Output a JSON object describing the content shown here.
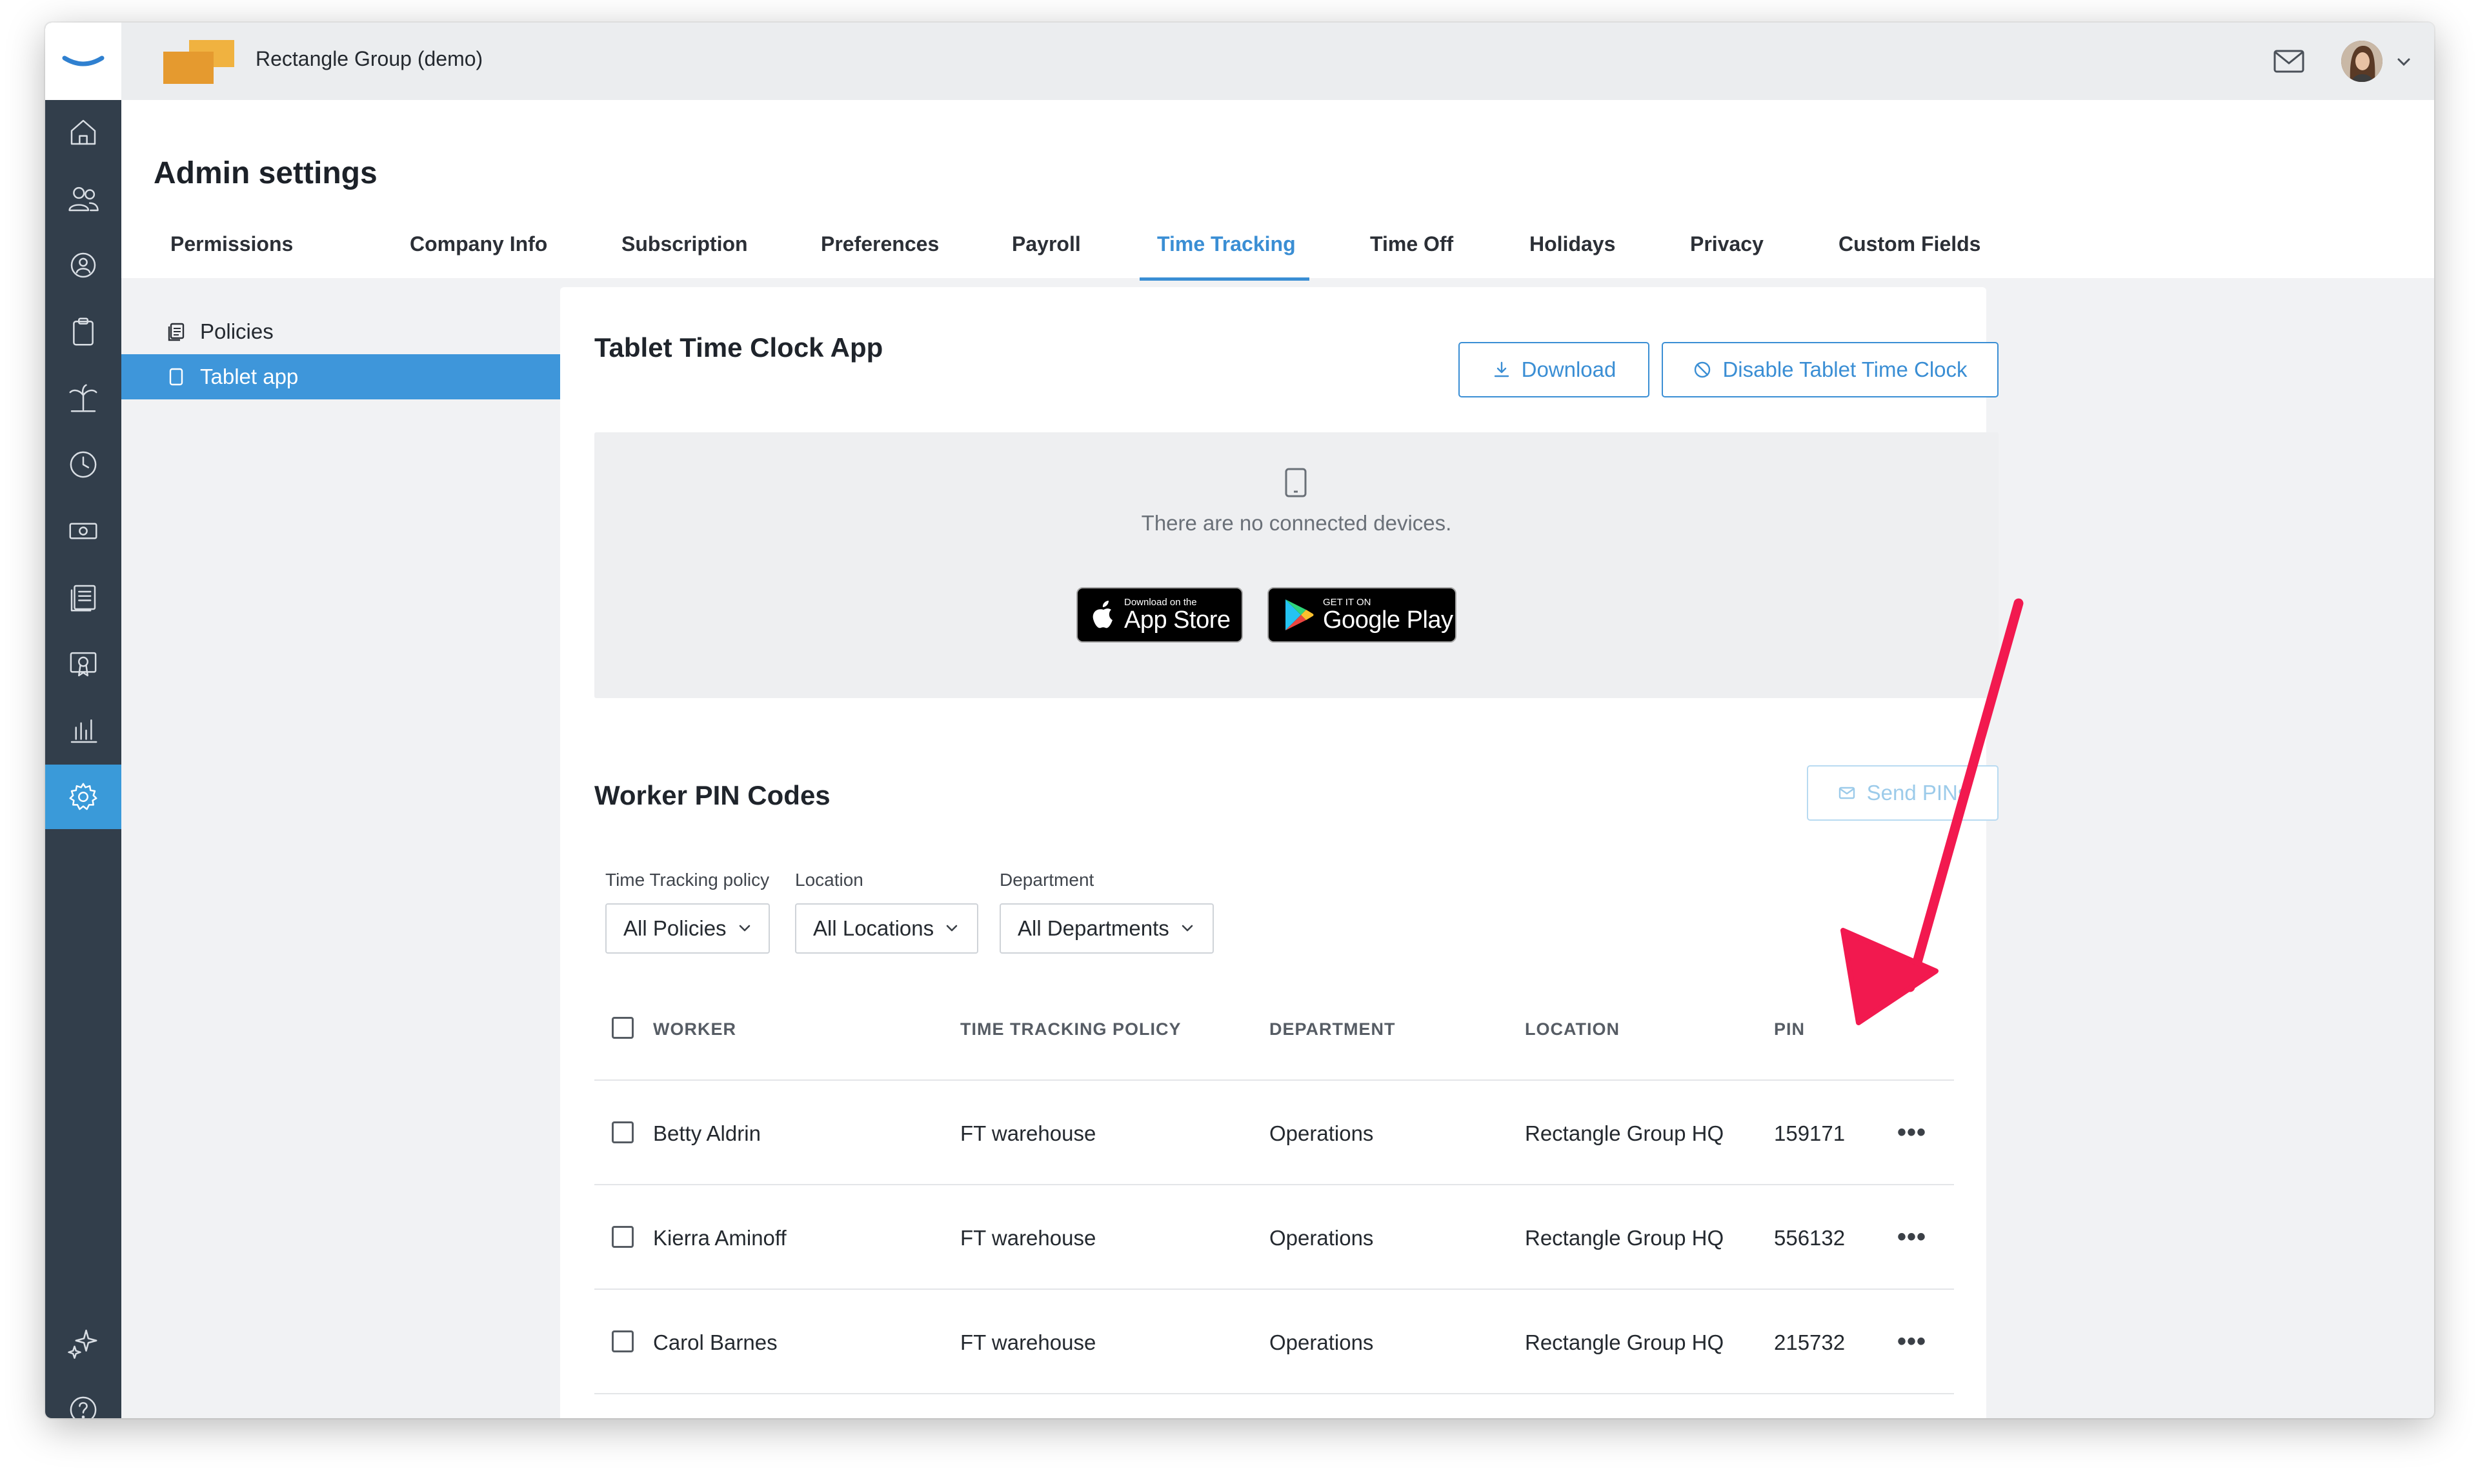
{
  "org": {
    "name": "Rectangle Group (demo)"
  },
  "header": {
    "title": "Admin settings"
  },
  "tabs": [
    {
      "label": "Permissions"
    },
    {
      "label": "Company Info"
    },
    {
      "label": "Subscription"
    },
    {
      "label": "Preferences"
    },
    {
      "label": "Payroll"
    },
    {
      "label": "Time Tracking",
      "active": true
    },
    {
      "label": "Time Off"
    },
    {
      "label": "Holidays"
    },
    {
      "label": "Privacy"
    },
    {
      "label": "Custom Fields"
    }
  ],
  "subnav": [
    {
      "label": "Policies",
      "icon": "policies-icon"
    },
    {
      "label": "Tablet app",
      "icon": "tablet-icon",
      "active": true
    }
  ],
  "tablet_section": {
    "title": "Tablet Time Clock App",
    "download_label": "Download",
    "disable_label": "Disable Tablet Time Clock",
    "empty_text": "There are no connected devices.",
    "app_store": {
      "small": "Download on the",
      "big": "App Store"
    },
    "google_play": {
      "small": "GET IT ON",
      "big": "Google Play"
    }
  },
  "pin_section": {
    "title": "Worker PIN Codes",
    "send_label": "Send PINs",
    "filters": [
      {
        "label": "Time Tracking policy",
        "value": "All Policies"
      },
      {
        "label": "Location",
        "value": "All Locations"
      },
      {
        "label": "Department",
        "value": "All Departments"
      }
    ],
    "columns": [
      "WORKER",
      "TIME TRACKING POLICY",
      "DEPARTMENT",
      "LOCATION",
      "PIN"
    ],
    "rows": [
      {
        "worker": "Betty Aldrin",
        "policy": "FT warehouse",
        "department": "Operations",
        "location": "Rectangle Group HQ",
        "pin": "159171"
      },
      {
        "worker": "Kierra Aminoff",
        "policy": "FT warehouse",
        "department": "Operations",
        "location": "Rectangle Group HQ",
        "pin": "556132"
      },
      {
        "worker": "Carol Barnes",
        "policy": "FT warehouse",
        "department": "Operations",
        "location": "Rectangle Group HQ",
        "pin": "215732"
      }
    ],
    "row_menu": "•••"
  },
  "colors": {
    "accent": "#3a8ed4",
    "sidebar": "#323e4b",
    "sidebar_active": "#3a9ad9",
    "annotation_arrow": "#f2194f",
    "org_logo": "#e9a23b"
  }
}
